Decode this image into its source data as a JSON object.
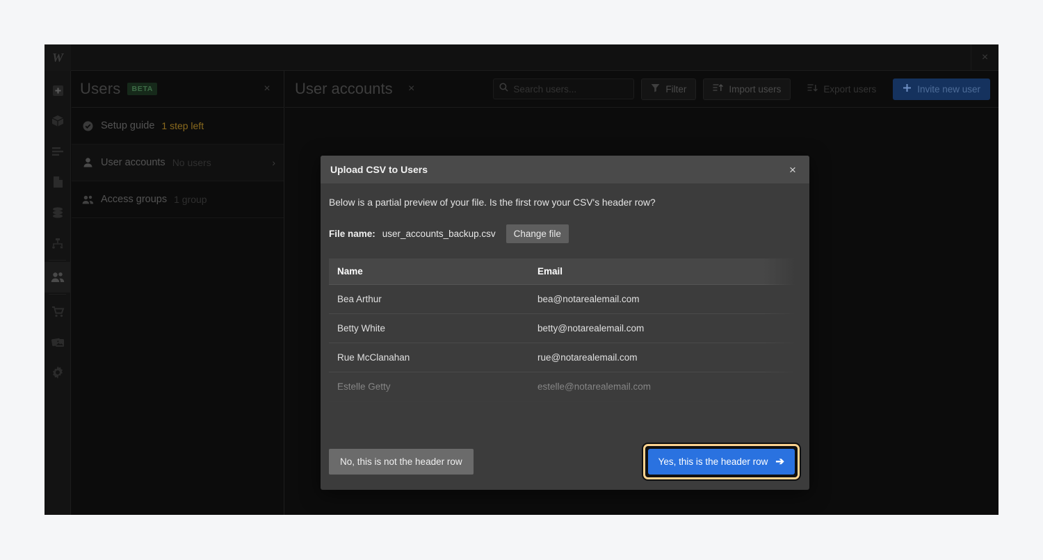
{
  "page": {
    "background_color": "#f5f6f8"
  },
  "window": {
    "logo": "W",
    "logo_icon": "webflow-w-logo-icon",
    "close_label": "×"
  },
  "rail": {
    "items": [
      {
        "icon": "plus-square-icon",
        "name": "add"
      },
      {
        "icon": "package-box-icon",
        "name": "components"
      },
      {
        "icon": "list-lines-icon",
        "name": "pages"
      },
      {
        "icon": "file-page-icon",
        "name": "file"
      },
      {
        "icon": "database-icon",
        "name": "cms"
      },
      {
        "icon": "workflow-node-icon",
        "name": "logic"
      },
      {
        "icon": "users-group-icon",
        "name": "users",
        "active": true
      },
      {
        "icon": "shopping-cart-icon",
        "name": "ecommerce"
      },
      {
        "icon": "images-stack-icon",
        "name": "assets"
      },
      {
        "icon": "gear-icon",
        "name": "settings"
      }
    ]
  },
  "left_panel": {
    "title": "Users",
    "badge": "BETA",
    "close_label": "×",
    "rows": [
      {
        "label": "Setup guide",
        "sub": "1 step left",
        "sub_warn": true,
        "icon": "check-circle-icon",
        "chevron": "",
        "selected": false
      },
      {
        "label": "User accounts",
        "sub": "No users",
        "sub_warn": false,
        "icon": "user-icon",
        "chevron": "›",
        "selected": true
      },
      {
        "label": "Access groups",
        "sub": "1 group",
        "sub_warn": false,
        "icon": "users-group-icon",
        "chevron": "",
        "selected": false
      }
    ]
  },
  "main": {
    "title": "User accounts",
    "close_label": "×",
    "search": {
      "value": "",
      "placeholder": "Search users..."
    },
    "buttons": {
      "filter": "Filter",
      "import": "Import users",
      "export": "Export users",
      "invite": "Invite new user"
    }
  },
  "modal": {
    "title": "Upload CSV to Users",
    "close_label": "×",
    "description": "Below is a partial preview of your file. Is the first row your CSV's header row?",
    "file_label": "File name:",
    "file_name": "user_accounts_backup.csv",
    "change_file_label": "Change file",
    "table": {
      "columns": [
        "Name",
        "Email",
        ""
      ],
      "rows": [
        {
          "cells": [
            "Bea Arthur",
            "bea@notarealemail.com",
            ""
          ],
          "faded": false
        },
        {
          "cells": [
            "Betty White",
            "betty@notarealemail.com",
            ""
          ],
          "faded": false
        },
        {
          "cells": [
            "Rue McClanahan",
            "rue@notarealemail.com",
            ""
          ],
          "faded": false
        },
        {
          "cells": [
            "Estelle Getty",
            "estelle@notarealemail.com",
            ""
          ],
          "faded": true
        }
      ]
    },
    "reject_label": "No, this is not the header row",
    "confirm_label": "Yes, this is the header row",
    "confirm_arrow": "➔"
  },
  "colors": {
    "accent_blue": "#2a72e0",
    "highlight_ring": "#fbd28f",
    "modal_bg": "#3c3c3c",
    "modal_header_bg": "#4a4a4a",
    "warn_text": "#8a6a1e",
    "beta_badge_bg": "#16291a",
    "beta_badge_text": "#3d6b46"
  }
}
